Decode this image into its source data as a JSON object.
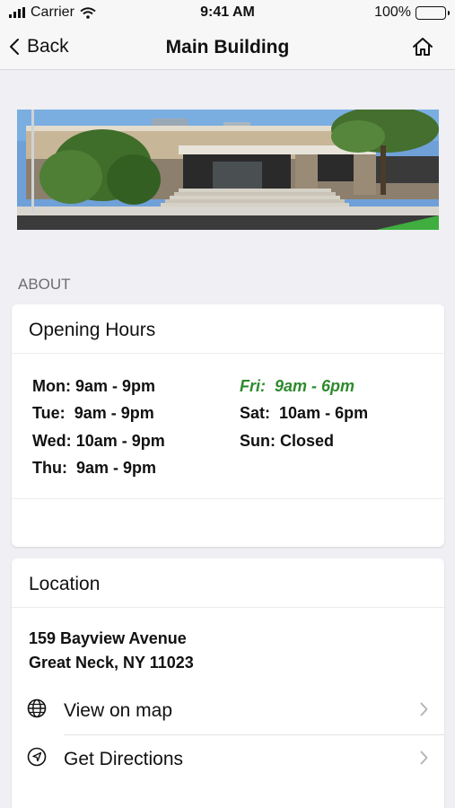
{
  "status_bar": {
    "carrier": "Carrier",
    "time": "9:41 AM",
    "battery": "100%"
  },
  "nav": {
    "back_label": "Back",
    "title": "Main Building"
  },
  "about": {
    "section_label": "ABOUT",
    "hours_card": {
      "title": "Opening Hours",
      "days": [
        {
          "day": "Mon:",
          "hours": "9am - 9pm",
          "today": false
        },
        {
          "day": "Tue:",
          "hours": "9am - 9pm",
          "today": false
        },
        {
          "day": "Wed:",
          "hours": "10am - 9pm",
          "today": false
        },
        {
          "day": "Thu:",
          "hours": "9am - 9pm",
          "today": false
        },
        {
          "day": "Fri:",
          "hours": "9am - 6pm",
          "today": true
        },
        {
          "day": "Sat:",
          "hours": "10am - 6pm",
          "today": false
        },
        {
          "day": "Sun:",
          "hours": "Closed",
          "today": false
        }
      ],
      "today_color": "#2e8b2e"
    },
    "location_card": {
      "title": "Location",
      "address_line1": "159 Bayview Avenue",
      "address_line2": "Great Neck, NY 11023",
      "links": [
        {
          "label": "View on map",
          "icon": "globe-icon"
        },
        {
          "label": "Get Directions",
          "icon": "compass-navigation-icon"
        }
      ]
    }
  }
}
